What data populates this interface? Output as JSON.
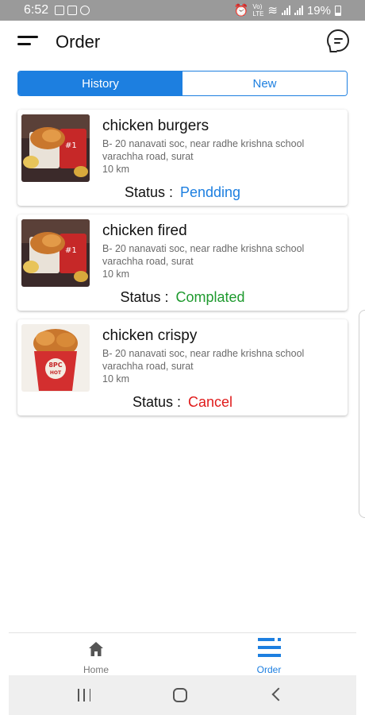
{
  "status_bar": {
    "time": "6:52",
    "battery": "19%",
    "network_label": "Vo) LTE"
  },
  "header": {
    "title": "Order"
  },
  "tabs": [
    {
      "label": "History",
      "active": true
    },
    {
      "label": "New",
      "active": false
    }
  ],
  "orders": [
    {
      "title": "chicken burgers",
      "address": "B- 20 nanavati soc, near radhe krishna school varachha road, surat",
      "distance": "10 km",
      "status_label": "Status :",
      "status": "Pendding",
      "status_color": "#1d7fe0"
    },
    {
      "title": "chicken fired",
      "address": "B- 20 nanavati soc, near radhe krishna school varachha road, surat",
      "distance": "10 km",
      "status_label": "Status :",
      "status": "Complated",
      "status_color": "#1e9a2e"
    },
    {
      "title": "chicken crispy",
      "address": "B- 20 nanavati soc, near radhe krishna school varachha road, surat",
      "distance": "10 km",
      "status_label": "Status :",
      "status": "Cancel",
      "status_color": "#e01b1b"
    }
  ],
  "bottom_nav": {
    "home_label": "Home",
    "order_label": "Order"
  },
  "colors": {
    "accent": "#1d7fe0"
  }
}
